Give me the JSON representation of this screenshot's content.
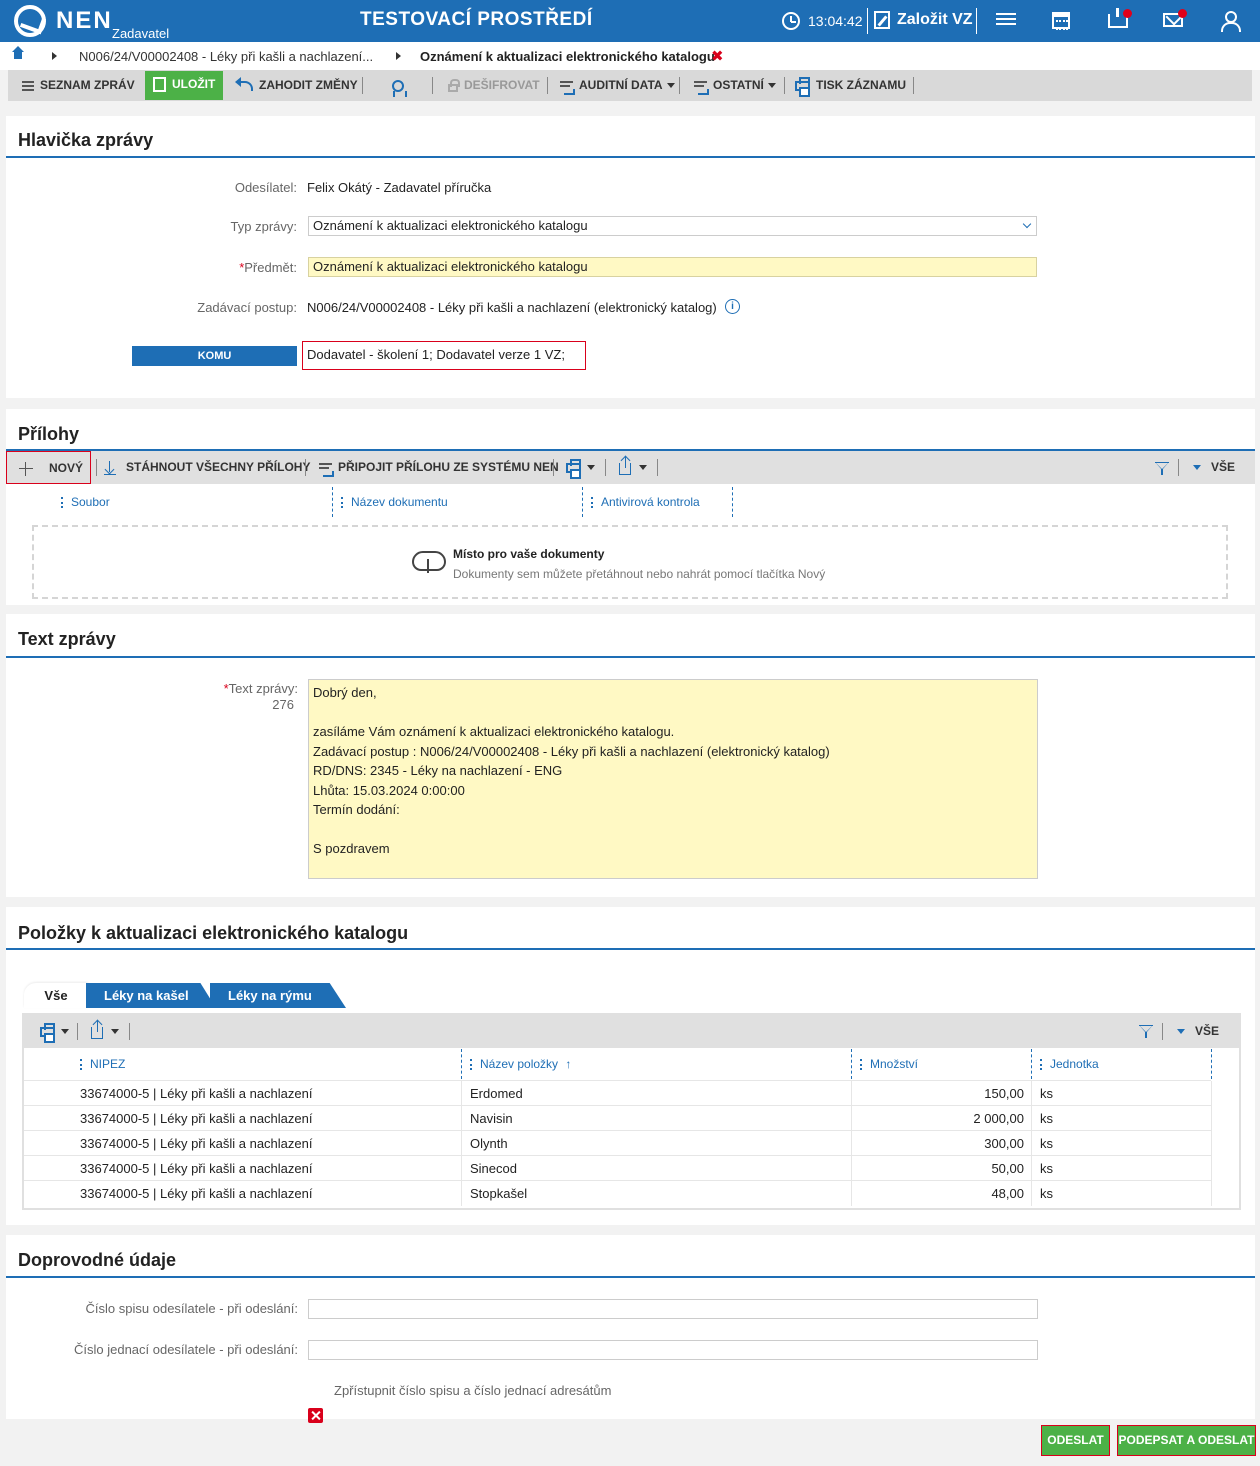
{
  "header": {
    "brand": "NEN",
    "brand_sub": "Zadavatel",
    "environment": "TESTOVACÍ PROSTŘEDÍ",
    "clock": "13:04:42",
    "create_label": "Založit VZ",
    "accent_color": "#1e6eb5"
  },
  "breadcrumb": {
    "items": [
      "N006/24/V00002408 - Léky při kašli a nachlazení...",
      "Oznámení k aktualizaci elektronického katalogu"
    ],
    "close_glyph": "✖"
  },
  "toolbar": {
    "list": "SEZNAM ZPRÁV",
    "save": "ULOŽIT",
    "discard": "ZAHODIT ZMĚNY",
    "decrypt": "DEŠIFROVAT",
    "audit": "AUDITNÍ DATA",
    "other": "OSTATNÍ",
    "print": "TISK ZÁZNAMU"
  },
  "message_header": {
    "title": "Hlavička zprávy",
    "sender_label": "Odesílatel:",
    "sender": "Felix Okátý - Zadavatel příručka",
    "type_label": "Typ zprávy:",
    "type_value": "Oznámení k aktualizaci elektronického katalogu",
    "subject_label": "Předmět:",
    "subject_value": "Oznámení k aktualizaci elektronického katalogu",
    "procedure_label": "Zadávací postup:",
    "procedure": "N006/24/V00002408 - Léky při kašli a nachlazení (elektronický katalog)",
    "to_button": "KOMU",
    "to_value": "Dodavatel - školení 1; Dodavatel verze 1 VZ;",
    "required_mark": "*",
    "info_glyph": "i"
  },
  "attachments": {
    "title": "Přílohy",
    "new": "NOVÝ",
    "download_all": "STÁHNOUT VŠECHNY PŘÍLOHY",
    "attach_system": "PŘIPOJIT PŘÍLOHU ZE SYSTÉMU NEN",
    "all": "VŠE",
    "columns": [
      "Soubor",
      "Název dokumentu",
      "Antivirová kontrola"
    ],
    "dropzone_title": "Místo pro vaše dokumenty",
    "dropzone_sub": "Dokumenty sem můžete přetáhnout nebo nahrát pomocí tlačítka Nový"
  },
  "message_text": {
    "title": "Text zprávy",
    "label": "Text zprávy:",
    "counter": "276",
    "body": "Dobrý den,\n\nzasíláme Vám oznámení k aktualizaci elektronického katalogu.\nZadávací postup : N006/24/V00002408 - Léky při kašli a nachlazení (elektronický katalog)\nRD/DNS: 2345 - Léky na nachlazení - ENG\nLhůta: 15.03.2024 0:00:00\nTermín dodání:\n\nS pozdravem"
  },
  "items": {
    "title": "Položky k aktualizaci elektronického katalogu",
    "tabs": [
      "Vše",
      "Léky na kašel",
      "Léky na rýmu"
    ],
    "all": "VŠE",
    "columns": [
      "NIPEZ",
      "Název položky",
      "Množství",
      "Jednotka"
    ],
    "sort_glyph": "↑",
    "rows": [
      {
        "nipez": "33674000-5 | Léky při kašli a nachlazení",
        "name": "Erdomed",
        "qty": "150,00",
        "unit": "ks"
      },
      {
        "nipez": "33674000-5 | Léky při kašli a nachlazení",
        "name": "Navisin",
        "qty": "2 000,00",
        "unit": "ks"
      },
      {
        "nipez": "33674000-5 | Léky při kašli a nachlazení",
        "name": "Olynth",
        "qty": "300,00",
        "unit": "ks"
      },
      {
        "nipez": "33674000-5 | Léky při kašli a nachlazení",
        "name": "Sinecod",
        "qty": "50,00",
        "unit": "ks"
      },
      {
        "nipez": "33674000-5 | Léky při kašli a nachlazení",
        "name": "Stopkašel",
        "qty": "48,00",
        "unit": "ks"
      }
    ]
  },
  "accompanying": {
    "title": "Doprovodné údaje",
    "file_no_label": "Číslo spisu odesílatele - při odeslání:",
    "ref_no_label": "Číslo jednací odesílatele - při odeslání:",
    "share_label": "Zpřístupnit číslo spisu a číslo jednací adresátům"
  },
  "footer": {
    "send": "ODESLAT",
    "sign_send": "PODEPSAT A ODESLAT"
  }
}
